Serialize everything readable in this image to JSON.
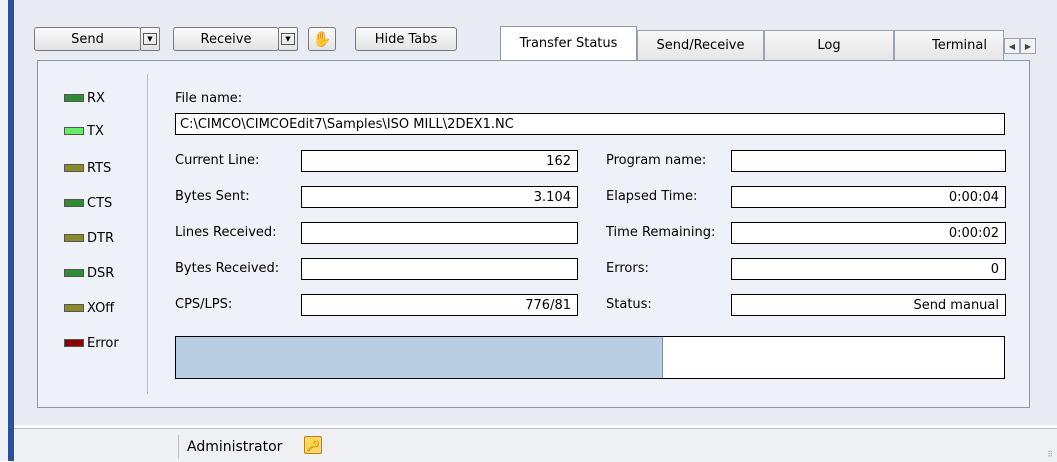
{
  "toolbar": {
    "send_label": "Send",
    "receive_label": "Receive",
    "hide_tabs_label": "Hide Tabs"
  },
  "tabs": [
    {
      "label": "Transfer Status",
      "active": true
    },
    {
      "label": "Send/Receive",
      "active": false
    },
    {
      "label": "Log",
      "active": false
    },
    {
      "label": "Terminal",
      "active": false
    }
  ],
  "leds": [
    {
      "label": "RX",
      "color": "#2e8b2e"
    },
    {
      "label": "TX",
      "color": "#66ee66"
    },
    {
      "label": "RTS",
      "color": "#8a8a2a"
    },
    {
      "label": "CTS",
      "color": "#2e8b2e"
    },
    {
      "label": "DTR",
      "color": "#8a8a2a"
    },
    {
      "label": "DSR",
      "color": "#2e8b2e"
    },
    {
      "label": "XOff",
      "color": "#8a8a2a"
    },
    {
      "label": "Error",
      "color": "#8b0000"
    }
  ],
  "file": {
    "label": "File name:",
    "value": "C:\\CIMCO\\CIMCOEdit7\\Samples\\ISO MILL\\2DEX1.NC"
  },
  "left_fields": [
    {
      "label": "Current Line:",
      "value": "162"
    },
    {
      "label": "Bytes Sent:",
      "value": "3.104"
    },
    {
      "label": "Lines Received:",
      "value": ""
    },
    {
      "label": "Bytes Received:",
      "value": ""
    },
    {
      "label": "CPS/LPS:",
      "value": "776/81"
    }
  ],
  "right_fields": [
    {
      "label": "Program name:",
      "value": ""
    },
    {
      "label": "Elapsed Time:",
      "value": "0:00:04"
    },
    {
      "label": "Time Remaining:",
      "value": "0:00:02"
    },
    {
      "label": "Errors:",
      "value": "0"
    },
    {
      "label": "Status:",
      "value": "Send manual"
    }
  ],
  "progress": {
    "fraction": 0.588,
    "color": "#b9cde3"
  },
  "statusbar": {
    "user": "Administrator"
  }
}
